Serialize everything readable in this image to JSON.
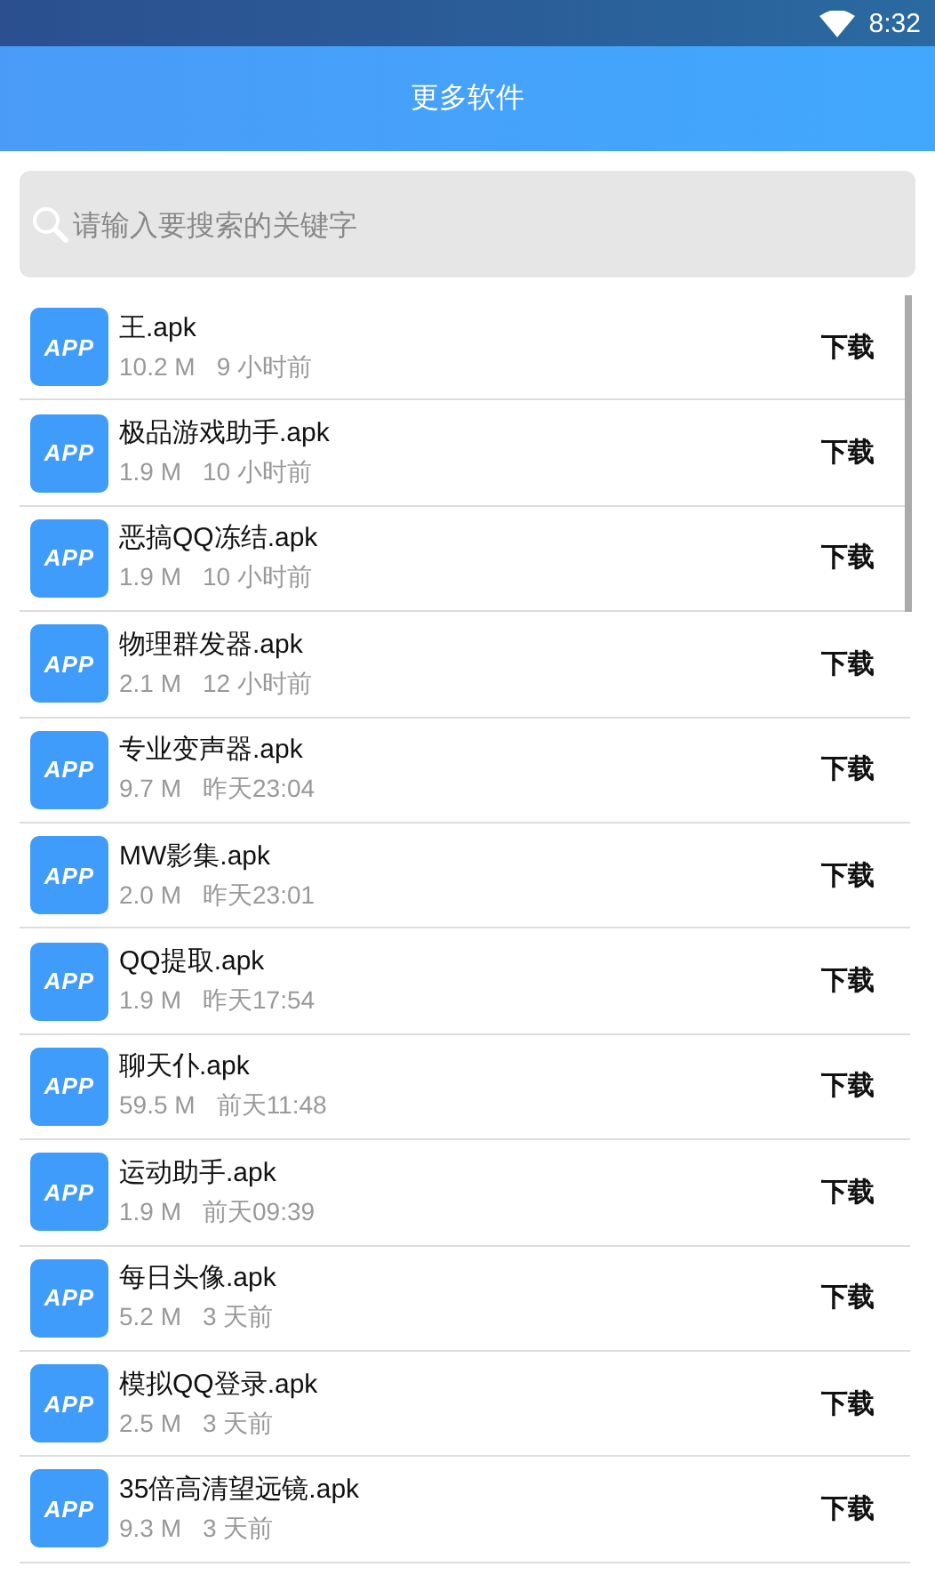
{
  "status_bar": {
    "time": "8:32"
  },
  "header": {
    "title": "更多软件"
  },
  "search": {
    "placeholder": "请输入要搜索的关键字"
  },
  "apps": [
    {
      "icon_text": "APP",
      "name": "王.apk",
      "size": "10.2 M",
      "time": "9 小时前",
      "action": "下载"
    },
    {
      "icon_text": "APP",
      "name": "极品游戏助手.apk",
      "size": "1.9 M",
      "time": "10 小时前",
      "action": "下载"
    },
    {
      "icon_text": "APP",
      "name": "恶搞QQ冻结.apk",
      "size": "1.9 M",
      "time": "10 小时前",
      "action": "下载"
    },
    {
      "icon_text": "APP",
      "name": "物理群发器.apk",
      "size": "2.1 M",
      "time": "12 小时前",
      "action": "下载"
    },
    {
      "icon_text": "APP",
      "name": "专业变声器.apk",
      "size": "9.7 M",
      "time": "昨天23:04",
      "action": "下载"
    },
    {
      "icon_text": "APP",
      "name": "MW影集.apk",
      "size": "2.0 M",
      "time": "昨天23:01",
      "action": "下载"
    },
    {
      "icon_text": "APP",
      "name": "QQ提取.apk",
      "size": "1.9 M",
      "time": "昨天17:54",
      "action": "下载"
    },
    {
      "icon_text": "APP",
      "name": "聊天仆.apk",
      "size": "59.5 M",
      "time": "前天11:48",
      "action": "下载"
    },
    {
      "icon_text": "APP",
      "name": "运动助手.apk",
      "size": "1.9 M",
      "time": "前天09:39",
      "action": "下载"
    },
    {
      "icon_text": "APP",
      "name": "每日头像.apk",
      "size": "5.2 M",
      "time": "3 天前",
      "action": "下载"
    },
    {
      "icon_text": "APP",
      "name": "模拟QQ登录.apk",
      "size": "2.5 M",
      "time": "3 天前",
      "action": "下载"
    },
    {
      "icon_text": "APP",
      "name": "35倍高清望远镜.apk",
      "size": "9.3 M",
      "time": "3 天前",
      "action": "下载"
    }
  ]
}
